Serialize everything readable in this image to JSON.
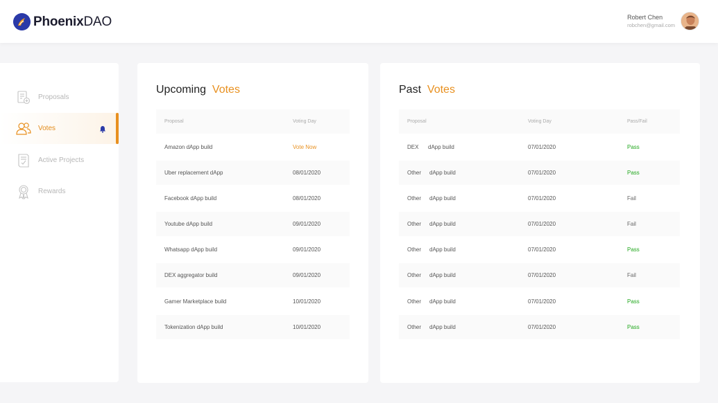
{
  "header": {
    "brand_bold": "Phoenix",
    "brand_light": "DAO",
    "user_name": "Robert Chen",
    "user_email": "robchen@gmail.com"
  },
  "sidebar": {
    "items": [
      {
        "label": "Proposals",
        "icon": "proposals-icon"
      },
      {
        "label": "Votes",
        "icon": "votes-icon"
      },
      {
        "label": "Active Projects",
        "icon": "active-projects-icon"
      },
      {
        "label": "Rewards",
        "icon": "rewards-icon"
      }
    ]
  },
  "upcoming": {
    "title_prefix": "Upcoming",
    "title_accent": "Votes",
    "columns": [
      "Proposal",
      "Voting Day"
    ],
    "rows": [
      {
        "proposal": "Amazon dApp build",
        "day": "Vote Now"
      },
      {
        "proposal": "Uber replacement dApp",
        "day": "08/01/2020"
      },
      {
        "proposal": "Facebook dApp build",
        "day": "08/01/2020"
      },
      {
        "proposal": "Youtube dApp build",
        "day": "09/01/2020"
      },
      {
        "proposal": "Whatsapp dApp build",
        "day": "09/01/2020"
      },
      {
        "proposal": "DEX aggregator build",
        "day": "09/01/2020"
      },
      {
        "proposal": "Gamer Marketplace build",
        "day": "10/01/2020"
      },
      {
        "proposal": "Tokenization dApp build",
        "day": "10/01/2020"
      }
    ]
  },
  "past": {
    "title_prefix": "Past",
    "title_accent": "Votes",
    "columns": [
      "Proposal",
      "Voting Day",
      "Pass/Fail"
    ],
    "rows": [
      {
        "type": "DEX",
        "proposal": "dApp build",
        "day": "07/01/2020",
        "result": "Pass"
      },
      {
        "type": "Other",
        "proposal": "dApp build",
        "day": "07/01/2020",
        "result": "Pass"
      },
      {
        "type": "Other",
        "proposal": "dApp build",
        "day": "07/01/2020",
        "result": "Fail"
      },
      {
        "type": "Other",
        "proposal": "dApp build",
        "day": "07/01/2020",
        "result": "Fail"
      },
      {
        "type": "Other",
        "proposal": "dApp build",
        "day": "07/01/2020",
        "result": "Pass"
      },
      {
        "type": "Other",
        "proposal": "dApp build",
        "day": "07/01/2020",
        "result": "Fail"
      },
      {
        "type": "Other",
        "proposal": "dApp build",
        "day": "07/01/2020",
        "result": "Pass"
      },
      {
        "type": "Other",
        "proposal": "dApp build",
        "day": "07/01/2020",
        "result": "Pass"
      }
    ]
  },
  "colors": {
    "accent": "#e8901f",
    "pass": "#22a81e",
    "brand": "#2b3aa8"
  }
}
